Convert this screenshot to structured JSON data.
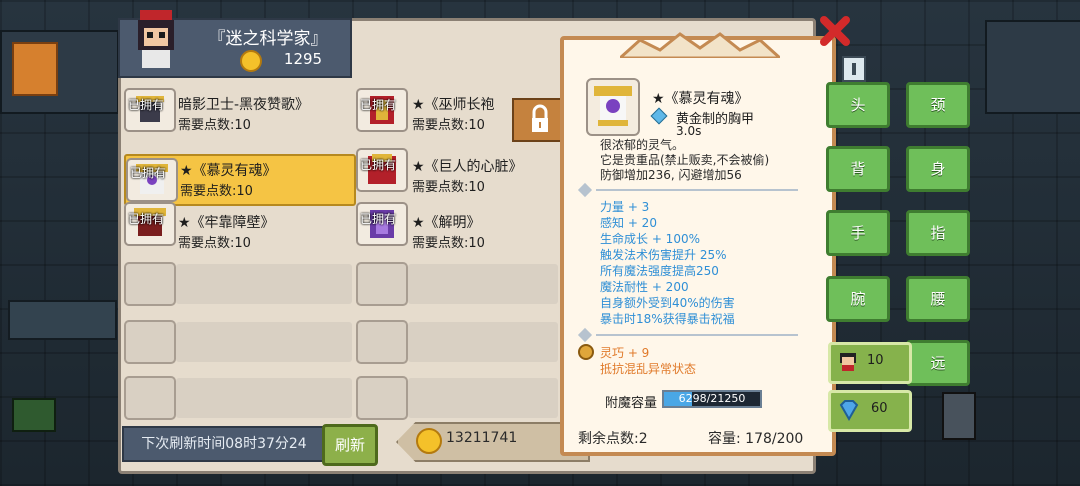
{
  "shop": {
    "title": "『迷之科学家』",
    "gold": "1295"
  },
  "left_items": [
    {
      "owned": "已拥有",
      "name": "暗影卫士-黑夜赞歌》",
      "points": "需要点数:10"
    },
    {
      "owned": "已拥有",
      "name": "★《慕灵有魂》",
      "points": "需要点数:10"
    },
    {
      "owned": "已拥有",
      "name": "★《牢靠障壁》",
      "points": "需要点数:10"
    }
  ],
  "right_items": [
    {
      "owned": "已拥有",
      "name": "★《巫师长袍",
      "points": "需要点数:10"
    },
    {
      "owned": "已拥有",
      "name": "★《巨人的心脏》",
      "points": "需要点数:10"
    },
    {
      "owned": "已拥有",
      "name": "★《解明》",
      "points": "需要点数:10"
    }
  ],
  "footer": {
    "refresh_time": "下次刷新时间08时37分24",
    "refresh_button": "刷新",
    "total_gold": "13211741",
    "remaining_points": "剩余点数:2",
    "capacity": "容量: 178/200"
  },
  "tooltip": {
    "name": "★《慕灵有魂》",
    "type": "黄金制的胸甲",
    "time": "3.0s",
    "desc": [
      "很浓郁的灵气。",
      "它是贵重品(禁止贩卖,不会被偷)",
      "防御增加236, 闪避增加56"
    ],
    "stats": [
      "力量 + 3",
      "感知 + 20",
      "生命成长 + 100%",
      "触发法术伤害提升 25%",
      "所有魔法强度提高250",
      "魔法耐性 + 200",
      "自身额外受到40%的伤害",
      "暴击时18%获得暴击祝福"
    ],
    "bonus": [
      "灵巧 + 9",
      "抵抗混乱异常状态"
    ],
    "enchant_label": "附魔容量",
    "enchant_value": "6298/21250",
    "enchant_fraction": 0.296
  },
  "equip_slots": [
    "头",
    "颈",
    "背",
    "身",
    "手",
    "指",
    "腕",
    "腰",
    "远"
  ],
  "currency": {
    "tickets": "10",
    "gems": "60"
  },
  "colors": {
    "accent_green": "#6fbf5a",
    "highlight": "#f5c444",
    "stat_blue": "#2f8fd6",
    "bonus_orange": "#e07a2a"
  }
}
